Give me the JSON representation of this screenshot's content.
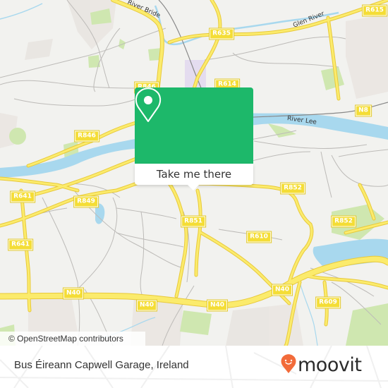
{
  "map": {
    "road_labels": [
      {
        "id": "r846-top",
        "text": "R846"
      },
      {
        "id": "r614",
        "text": "R614"
      },
      {
        "id": "r635",
        "text": "R635"
      },
      {
        "id": "r615",
        "text": "R615"
      },
      {
        "id": "n8",
        "text": "N8"
      },
      {
        "id": "r846",
        "text": "R846"
      },
      {
        "id": "r641-a",
        "text": "R641"
      },
      {
        "id": "r849",
        "text": "R849"
      },
      {
        "id": "r852-a",
        "text": "R852"
      },
      {
        "id": "r851",
        "text": "R851"
      },
      {
        "id": "r610",
        "text": "R610"
      },
      {
        "id": "r852-b",
        "text": "R852"
      },
      {
        "id": "r641-b",
        "text": "R641"
      },
      {
        "id": "n40-a",
        "text": "N40"
      },
      {
        "id": "n40-b",
        "text": "N40"
      },
      {
        "id": "n40-c",
        "text": "N40"
      },
      {
        "id": "n40-d",
        "text": "N40"
      },
      {
        "id": "r609",
        "text": "R609"
      }
    ],
    "water_labels": [
      {
        "id": "river-bride",
        "text": "River Bride"
      },
      {
        "id": "glen-river",
        "text": "Glen River"
      },
      {
        "id": "river-lee",
        "text": "River Lee"
      }
    ],
    "attribution": "© OpenStreetMap contributors"
  },
  "popup": {
    "icon": "map-pin-icon",
    "button_label": "Take me there"
  },
  "footer": {
    "location_name": "Bus Éireann Capwell Garage, Ireland",
    "brand": "moovit",
    "brand_color": "#f26b3a"
  },
  "colors": {
    "popup_green": "#1db86a",
    "road_yellow": "#f4dd36",
    "water_blue": "#a8d8ee",
    "park_green": "#cfe7b0",
    "map_bg": "#f2f2ef"
  }
}
